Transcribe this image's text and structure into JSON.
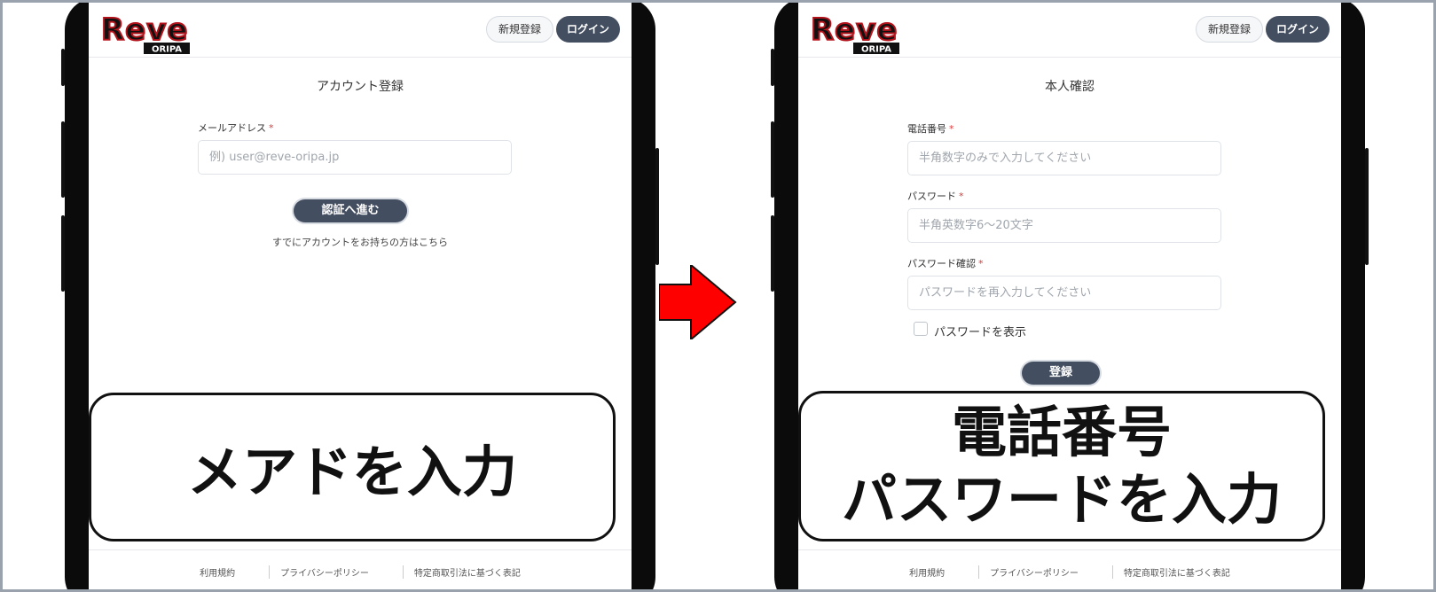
{
  "header": {
    "logo_text": "Reve",
    "logo_sub": "ORIPA",
    "register_label": "新規登録",
    "login_label": "ログイン"
  },
  "left": {
    "title": "アカウント登録",
    "email_label": "メールアドレス",
    "required_mark": "*",
    "email_placeholder": "例) user@reve-oripa.jp",
    "proceed_label": "認証へ進む",
    "existing_account_link": "すでにアカウントをお持ちの方はこちら",
    "caption": "メアドを入力"
  },
  "right": {
    "title": "本人確認",
    "phone_label": "電話番号",
    "phone_placeholder": "半角数字のみで入力してください",
    "password_label": "パスワード",
    "password_placeholder": "半角英数字6～20文字",
    "password_confirm_label": "パスワード確認",
    "password_confirm_placeholder": "パスワードを再入力してください",
    "show_password_label": "パスワードを表示",
    "submit_label": "登録",
    "caption_line1": "電話番号",
    "caption_line2": "パスワードを入力"
  },
  "footer": {
    "links": [
      "利用規約",
      "プライバシーポリシー",
      "特定商取引法に基づく表記"
    ]
  },
  "colors": {
    "primary_button": "#434e61",
    "required": "#e03a3a",
    "arrow": "#ff0000"
  }
}
